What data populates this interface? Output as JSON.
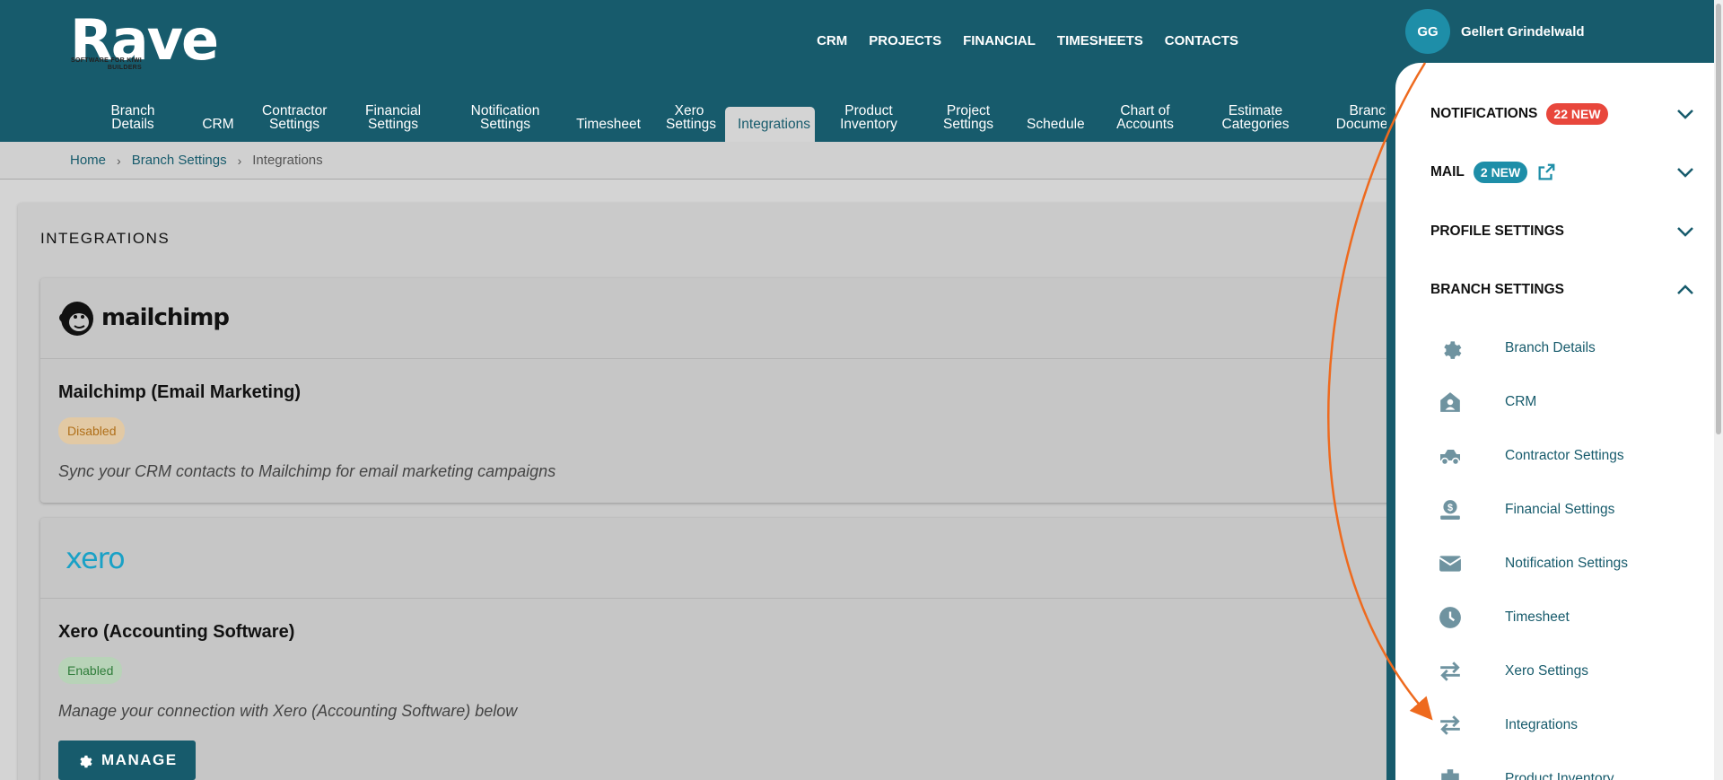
{
  "brand": {
    "name": "Rave",
    "tagline": "SOFTWARE FOR KIWI BUILDERS"
  },
  "topnav": [
    "CRM",
    "PROJECTS",
    "FINANCIAL",
    "TIMESHEETS",
    "CONTACTS"
  ],
  "subnav": [
    "Branch Details",
    "CRM",
    "Contractor Settings",
    "Financial Settings",
    "Notification Settings",
    "Timesheet",
    "Xero Settings",
    "Integrations",
    "Product Inventory",
    "Project Settings",
    "Schedule",
    "Chart of Accounts",
    "Estimate Categories",
    "Branch Documents"
  ],
  "active_tab": "Integrations",
  "breadcrumb": {
    "home": "Home",
    "branch_settings": "Branch Settings",
    "current": "Integrations",
    "separator": "›"
  },
  "main": {
    "title": "INTEGRATIONS",
    "mailchimp": {
      "logo_text": "mailchimp",
      "name": "Mailchimp (Email Marketing)",
      "status": "Disabled",
      "description": "Sync your CRM contacts to Mailchimp for email marketing campaigns"
    },
    "xero": {
      "logo_text": "xero",
      "name": "Xero (Accounting Software)",
      "status": "Enabled",
      "description": "Manage your connection with Xero (Accounting Software) below",
      "button": "MANAGE"
    }
  },
  "drawer": {
    "user_initials": "GG",
    "user_name": "Gellert Grindelwald",
    "notifications": {
      "label": "NOTIFICATIONS",
      "badge": "22 NEW"
    },
    "mail": {
      "label": "MAIL",
      "badge": "2 NEW"
    },
    "profile": {
      "label": "PROFILE SETTINGS"
    },
    "branch": {
      "label": "BRANCH SETTINGS"
    },
    "items": [
      {
        "label": "Branch Details",
        "icon": "gear-icon"
      },
      {
        "label": "CRM",
        "icon": "house-user-icon"
      },
      {
        "label": "Contractor Settings",
        "icon": "truck-icon"
      },
      {
        "label": "Financial Settings",
        "icon": "money-icon"
      },
      {
        "label": "Notification Settings",
        "icon": "envelope-icon"
      },
      {
        "label": "Timesheet",
        "icon": "clock-icon"
      },
      {
        "label": "Xero Settings",
        "icon": "swap-icon"
      },
      {
        "label": "Integrations",
        "icon": "swap-icon"
      },
      {
        "label": "Product Inventory",
        "icon": "box-icon"
      }
    ]
  },
  "colors": {
    "primary": "#175b6c",
    "accent": "#1e8ea8",
    "badge_red": "#e8473c",
    "annotation_arrow": "#ee6a1e"
  }
}
